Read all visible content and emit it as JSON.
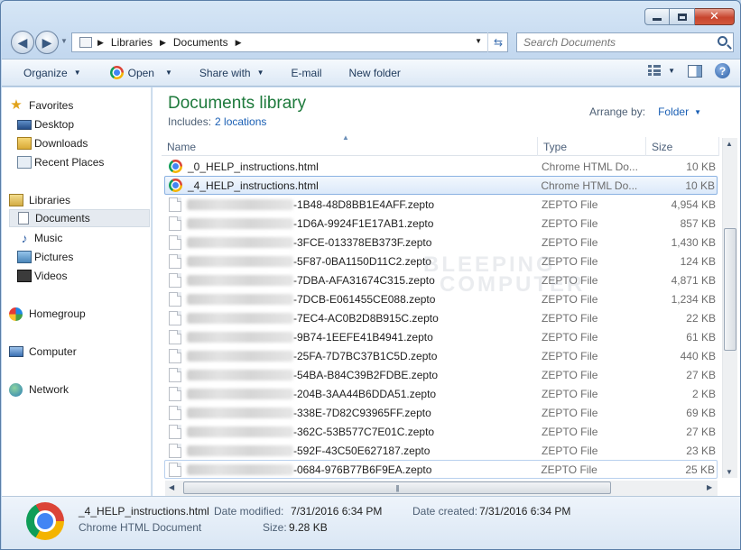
{
  "window": {
    "search_placeholder": "Search Documents"
  },
  "address": {
    "crumbs": [
      "Libraries",
      "Documents"
    ]
  },
  "toolbar": {
    "organize": "Organize",
    "open": "Open",
    "share_with": "Share with",
    "email": "E-mail",
    "new_folder": "New folder"
  },
  "nav": {
    "favorites": "Favorites",
    "desktop": "Desktop",
    "downloads": "Downloads",
    "recent_places": "Recent Places",
    "libraries": "Libraries",
    "documents": "Documents",
    "music": "Music",
    "pictures": "Pictures",
    "videos": "Videos",
    "homegroup": "Homegroup",
    "computer": "Computer",
    "network": "Network"
  },
  "library": {
    "title": "Documents library",
    "includes_label": "Includes:",
    "locations": "2 locations",
    "arrange_label": "Arrange by:",
    "arrange_value": "Folder"
  },
  "columns": {
    "name": "Name",
    "type": "Type",
    "size": "Size"
  },
  "files": [
    {
      "name": "_0_HELP_instructions.html",
      "type": "Chrome HTML Do...",
      "size": "10 KB"
    },
    {
      "name": "_4_HELP_instructions.html",
      "type": "Chrome HTML Do...",
      "size": "10 KB"
    },
    {
      "name": "-1B48-48D8BB1E4AFF.zepto",
      "type": "ZEPTO File",
      "size": "4,954 KB"
    },
    {
      "name": "-1D6A-9924F1E17AB1.zepto",
      "type": "ZEPTO File",
      "size": "857 KB"
    },
    {
      "name": "-3FCE-013378EB373F.zepto",
      "type": "ZEPTO File",
      "size": "1,430 KB"
    },
    {
      "name": "-5F87-0BA1150D11C2.zepto",
      "type": "ZEPTO File",
      "size": "124 KB"
    },
    {
      "name": "-7DBA-AFA31674C315.zepto",
      "type": "ZEPTO File",
      "size": "4,871 KB"
    },
    {
      "name": "-7DCB-E061455CE088.zepto",
      "type": "ZEPTO File",
      "size": "1,234 KB"
    },
    {
      "name": "-7EC4-AC0B2D8B915C.zepto",
      "type": "ZEPTO File",
      "size": "22 KB"
    },
    {
      "name": "-9B74-1EEFE41B4941.zepto",
      "type": "ZEPTO File",
      "size": "61 KB"
    },
    {
      "name": "-25FA-7D7BC37B1C5D.zepto",
      "type": "ZEPTO File",
      "size": "440 KB"
    },
    {
      "name": "-54BA-B84C39B2FDBE.zepto",
      "type": "ZEPTO File",
      "size": "27 KB"
    },
    {
      "name": "-204B-3AA44B6DDA51.zepto",
      "type": "ZEPTO File",
      "size": "2 KB"
    },
    {
      "name": "-338E-7D82C93965FF.zepto",
      "type": "ZEPTO File",
      "size": "69 KB"
    },
    {
      "name": "-362C-53B577C7E01C.zepto",
      "type": "ZEPTO File",
      "size": "27 KB"
    },
    {
      "name": "-592F-43C50E627187.zepto",
      "type": "ZEPTO File",
      "size": "23 KB"
    },
    {
      "name": "-0684-976B77B6F9EA.zepto",
      "type": "ZEPTO File",
      "size": "25 KB"
    }
  ],
  "selected_index": 1,
  "hover_index": 16,
  "details": {
    "file_name": "_4_HELP_instructions.html",
    "file_type": "Chrome HTML Document",
    "date_modified_label": "Date modified:",
    "date_modified": "7/31/2016 6:34 PM",
    "date_created_label": "Date created:",
    "date_created": "7/31/2016 6:34 PM",
    "size_label": "Size:",
    "size": "9.28 KB"
  },
  "watermark": [
    "BLEEPING",
    "COMPUTER"
  ]
}
